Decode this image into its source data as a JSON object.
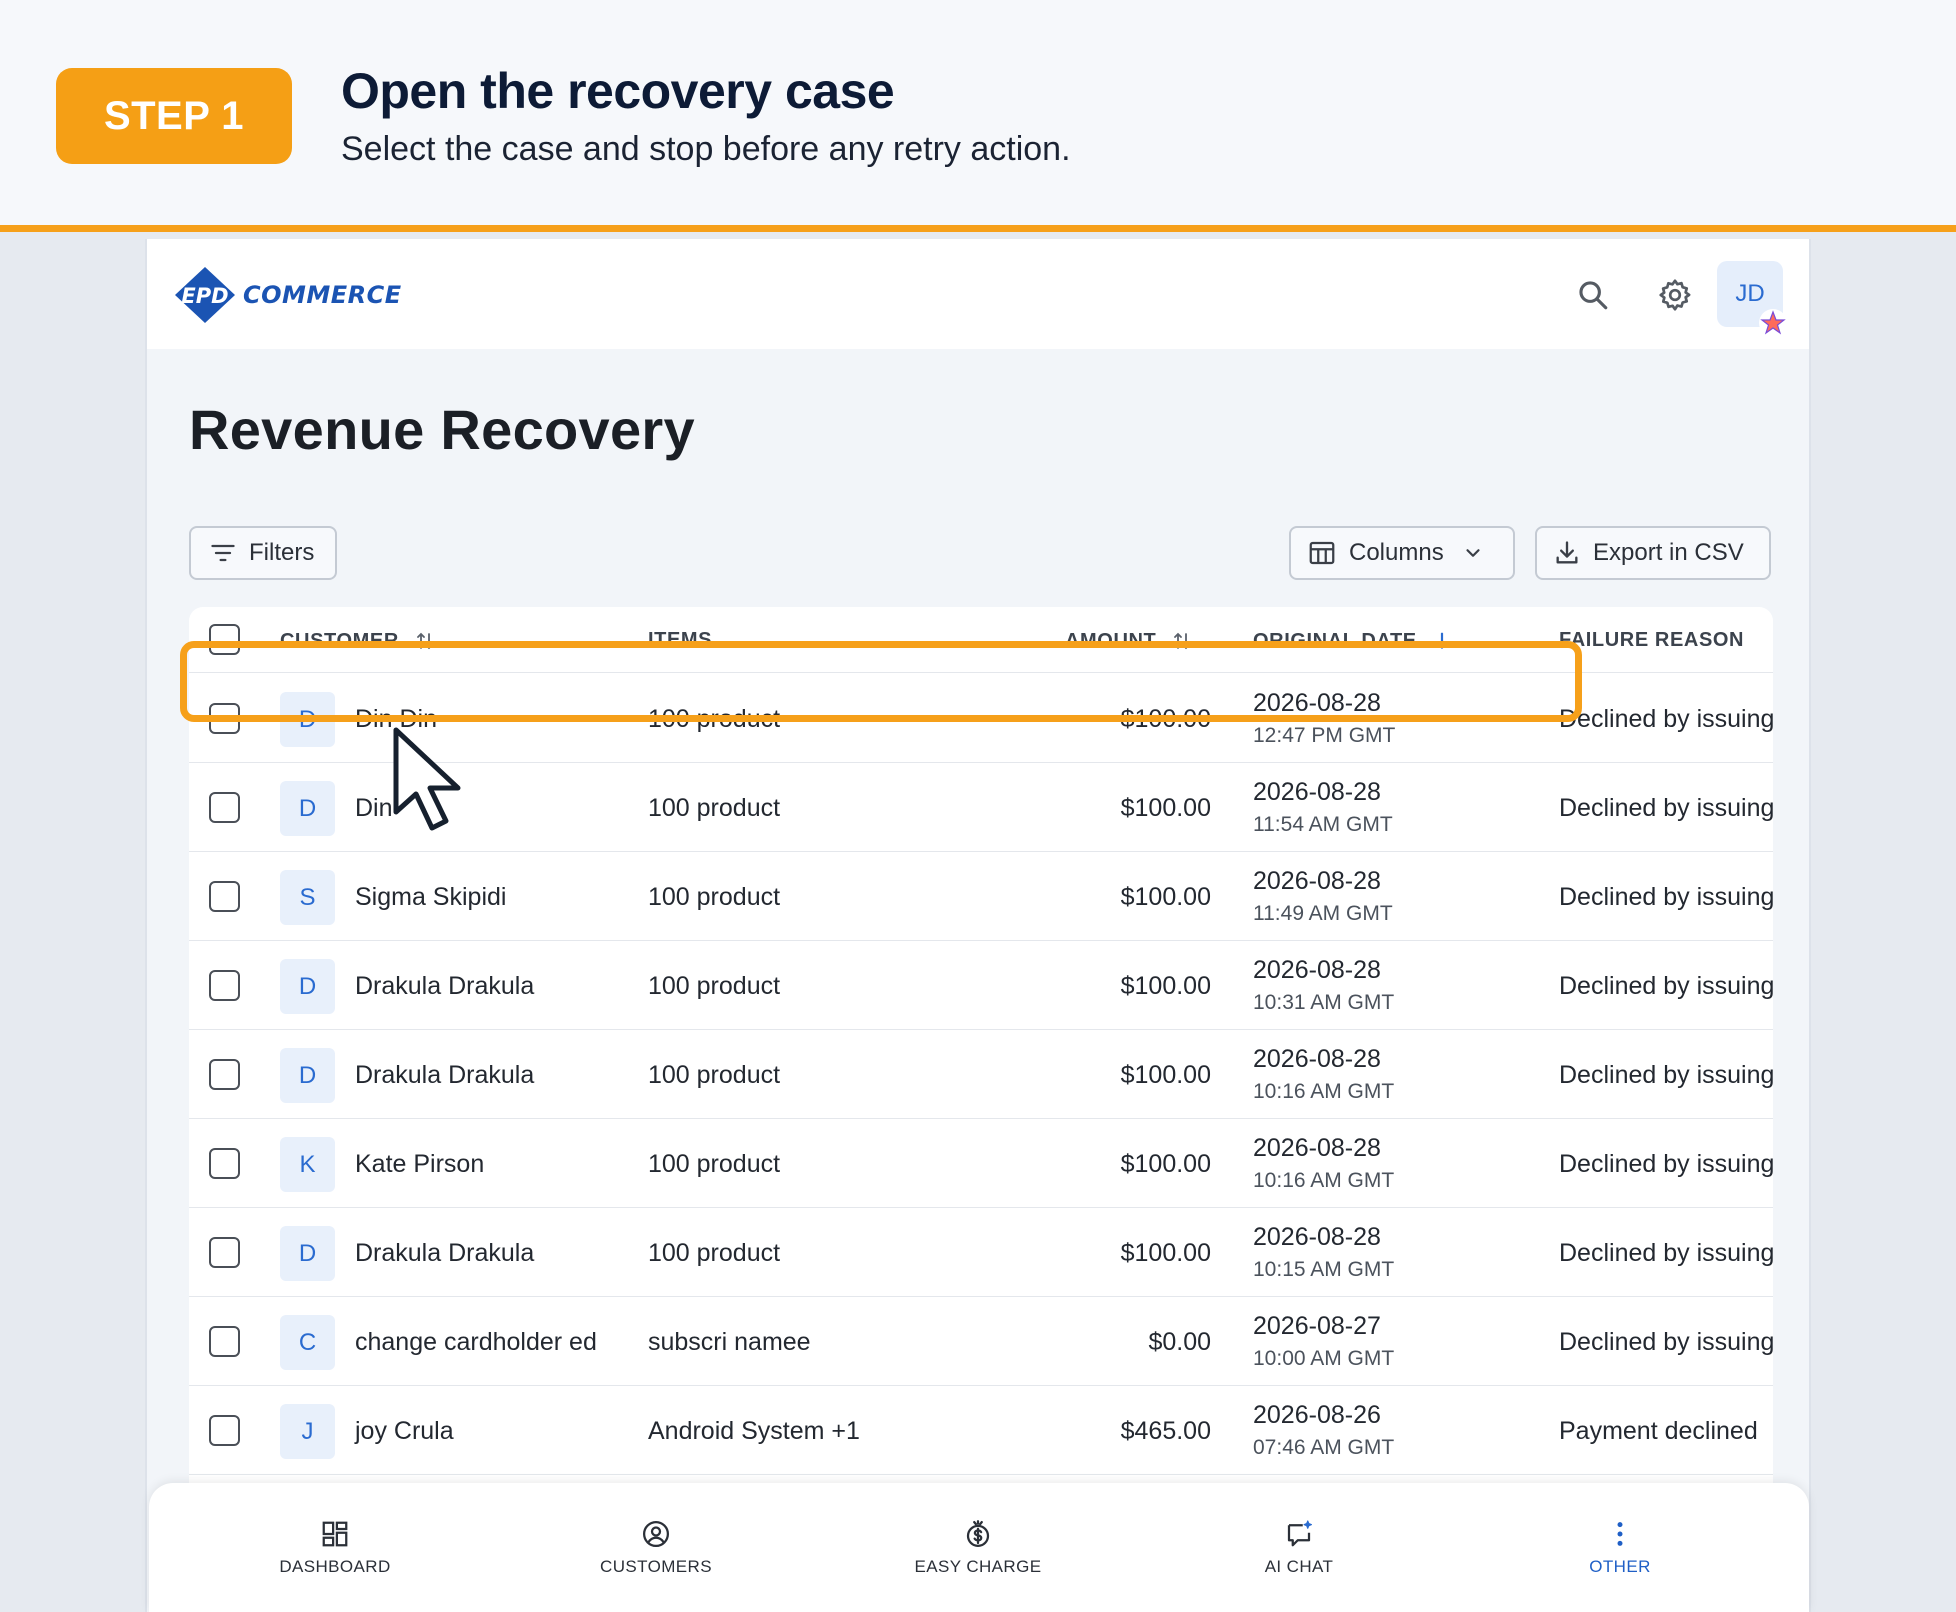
{
  "step": {
    "badge": "STEP 1",
    "title": "Open the recovery case",
    "subtitle": "Select the case and stop before any retry action."
  },
  "header": {
    "logo_mark": "EPD",
    "logo_text": "COMMERCE",
    "avatar_initials": "JD"
  },
  "page": {
    "title": "Revenue Recovery"
  },
  "toolbar": {
    "filters_label": "Filters",
    "columns_label": "Columns",
    "export_label": "Export in CSV"
  },
  "table": {
    "columns": [
      "CUSTOMER",
      "ITEMS",
      "AMOUNT",
      "ORIGINAL DATE",
      "FAILURE REASON"
    ],
    "rows": [
      {
        "initial": "D",
        "customer": "Din Din",
        "items": "100 product",
        "amount": "$100.00",
        "date": "2026-08-28",
        "time": "12:47 PM GMT",
        "reason": "Declined by issuing"
      },
      {
        "initial": "D",
        "customer": "Din",
        "items": "100 product",
        "amount": "$100.00",
        "date": "2026-08-28",
        "time": "11:54 AM GMT",
        "reason": "Declined by issuing"
      },
      {
        "initial": "S",
        "customer": "Sigma Skipidi",
        "items": "100 product",
        "amount": "$100.00",
        "date": "2026-08-28",
        "time": "11:49 AM GMT",
        "reason": "Declined by issuing"
      },
      {
        "initial": "D",
        "customer": "Drakula Drakula",
        "items": "100 product",
        "amount": "$100.00",
        "date": "2026-08-28",
        "time": "10:31 AM GMT",
        "reason": "Declined by issuing"
      },
      {
        "initial": "D",
        "customer": "Drakula Drakula",
        "items": "100 product",
        "amount": "$100.00",
        "date": "2026-08-28",
        "time": "10:16 AM GMT",
        "reason": "Declined by issuing"
      },
      {
        "initial": "K",
        "customer": "Kate Pirson",
        "items": "100 product",
        "amount": "$100.00",
        "date": "2026-08-28",
        "time": "10:16 AM GMT",
        "reason": "Declined by issuing"
      },
      {
        "initial": "D",
        "customer": "Drakula Drakula",
        "items": "100 product",
        "amount": "$100.00",
        "date": "2026-08-28",
        "time": "10:15 AM GMT",
        "reason": "Declined by issuing"
      },
      {
        "initial": "C",
        "customer": "change cardholder ed",
        "items": "subscri namee",
        "amount": "$0.00",
        "date": "2026-08-27",
        "time": "10:00 AM GMT",
        "reason": "Declined by issuing"
      },
      {
        "initial": "J",
        "customer": "joy Crula",
        "items": "Android System +1",
        "amount": "$465.00",
        "date": "2026-08-26",
        "time": "07:46 AM GMT",
        "reason": "Payment declined"
      }
    ]
  },
  "nav": {
    "items": [
      {
        "label": "DASHBOARD",
        "icon": "dashboard-icon"
      },
      {
        "label": "CUSTOMERS",
        "icon": "user-circle-icon"
      },
      {
        "label": "EASY CHARGE",
        "icon": "dollar-icon"
      },
      {
        "label": "AI CHAT",
        "icon": "chat-icon"
      },
      {
        "label": "OTHER",
        "icon": "more-vertical-icon"
      }
    ],
    "active": "OTHER"
  },
  "colors": {
    "accent_orange": "#f59f15",
    "brand_blue": "#1b54b3",
    "active_nav": "#1f5fc6"
  }
}
